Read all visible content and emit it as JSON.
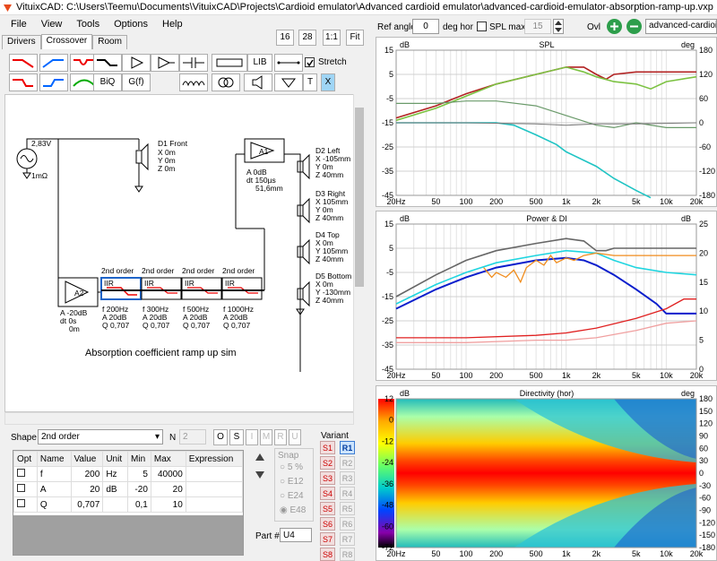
{
  "window": {
    "title": "VituixCAD: C:\\Users\\Teemu\\Documents\\VituixCAD\\Projects\\Cardioid emulator\\Advanced cardioid emulator\\advanced-cardioid-emulator-absorption-ramp-up.vxp"
  },
  "menu": [
    "File",
    "View",
    "Tools",
    "Options",
    "Help"
  ],
  "tabs": [
    "Drivers",
    "Crossover",
    "Room"
  ],
  "zoom": {
    "b1": "16",
    "b2": "28",
    "b3": "1:1",
    "b4": "Fit"
  },
  "toolbar": {
    "lib": "LIB",
    "biq": "BiQ",
    "gf": "G(f)",
    "t": "T",
    "x": "X",
    "stretch": "Stretch"
  },
  "header": {
    "ref_angle_label": "Ref angle",
    "ref_angle": "0",
    "deg_hor": "deg hor",
    "spl_max": "SPL max",
    "spl_max_val": "15",
    "ovl": "Ovl",
    "file_field": "advanced-cardioid-emulator"
  },
  "schematic": {
    "source": {
      "volt": "2,83V",
      "res": "1mΩ"
    },
    "d1": {
      "name": "D1 Front",
      "x": "X 0m",
      "y": "Y 0m",
      "z": "Z 0m"
    },
    "a1": {
      "name": "A1",
      "gain": "A  0dB",
      "dt": "dt 150µs",
      "dist": "51,6mm"
    },
    "d2": {
      "name": "D2 Left",
      "x": "X -105mm",
      "y": "Y 0m",
      "z": "Z 40mm"
    },
    "d3": {
      "name": "D3 Right",
      "x": "X 105mm",
      "y": "Y 0m",
      "z": "Z 40mm"
    },
    "d4": {
      "name": "D4 Top",
      "x": "X 0m",
      "y": "Y 105mm",
      "z": "Z 40mm"
    },
    "d5": {
      "name": "D5 Bottom",
      "x": "X 0m",
      "y": "Y -130mm",
      "z": "Z 40mm"
    },
    "a2": {
      "name": "A2",
      "gain": "A  -20dB",
      "dt": "dt 0s",
      "dist": "0m"
    },
    "iir_title": "2nd order",
    "iir": [
      {
        "lbl": "IIR",
        "f": "f  200Hz",
        "a": "A  20dB",
        "q": "Q  0,707"
      },
      {
        "lbl": "IIR",
        "f": "f  300Hz",
        "a": "A  20dB",
        "q": "Q  0,707"
      },
      {
        "lbl": "IIR",
        "f": "f  500Hz",
        "a": "A  20dB",
        "q": "Q  0,707"
      },
      {
        "lbl": "IIR",
        "f": "f  1000Hz",
        "a": "A  20dB",
        "q": "Q  0,707"
      }
    ],
    "caption": "Absorption coefficient ramp up sim"
  },
  "bottom": {
    "shape_label": "Shape",
    "shape_value": "2nd order",
    "n_label": "N",
    "n_value": "2",
    "btns": [
      "O",
      "S",
      "I",
      "M",
      "R",
      "U"
    ],
    "cols": [
      "Opt",
      "Name",
      "Value",
      "Unit",
      "Min",
      "Max",
      "Expression"
    ],
    "rows": [
      {
        "name": "f",
        "value": "200",
        "unit": "Hz",
        "min": "5",
        "max": "40000"
      },
      {
        "name": "A",
        "value": "20",
        "unit": "dB",
        "min": "-20",
        "max": "20"
      },
      {
        "name": "Q",
        "value": "0,707",
        "unit": "",
        "min": "0,1",
        "max": "10"
      }
    ],
    "snap_label": "Snap",
    "snap": [
      "5 %",
      "E12",
      "E24",
      "E48"
    ],
    "part_label": "Part #",
    "part_value": "U4",
    "variant_label": "Variant",
    "variants_s": [
      "S1",
      "S2",
      "S3",
      "S4",
      "S5",
      "S6",
      "S7",
      "S8"
    ],
    "variants_r": [
      "R1",
      "R2",
      "R3",
      "R4",
      "R5",
      "R6",
      "R7",
      "R8"
    ]
  },
  "charts": {
    "spl": {
      "title": "SPL",
      "yl": "dB",
      "yr": "deg",
      "yticks": [
        "15",
        "5",
        "-5",
        "-15",
        "-25",
        "-35",
        "-45"
      ],
      "rticks": [
        "180",
        "120",
        "60",
        "0",
        "-60",
        "-120",
        "-180"
      ]
    },
    "power": {
      "title": "Power & DI",
      "yl": "dB",
      "yr": "dB",
      "yticks": [
        "15",
        "5",
        "-5",
        "-15",
        "-25",
        "-35",
        "-45"
      ],
      "rticks": [
        "25",
        "20",
        "15",
        "10",
        "5",
        "0"
      ]
    },
    "dir": {
      "title": "Directivity (hor)",
      "yl": "dB",
      "yr": "deg",
      "yticks": [
        "12",
        "0",
        "-12",
        "-24",
        "-36",
        "-48",
        "-60",
        "-72"
      ],
      "rticks": [
        "180",
        "150",
        "120",
        "90",
        "60",
        "30",
        "0",
        "-30",
        "-60",
        "-90",
        "-120",
        "-150",
        "-180"
      ]
    },
    "xticks": [
      "20Hz",
      "50",
      "100",
      "200",
      "500",
      "1k",
      "2k",
      "5k",
      "10k",
      "20k"
    ]
  }
}
